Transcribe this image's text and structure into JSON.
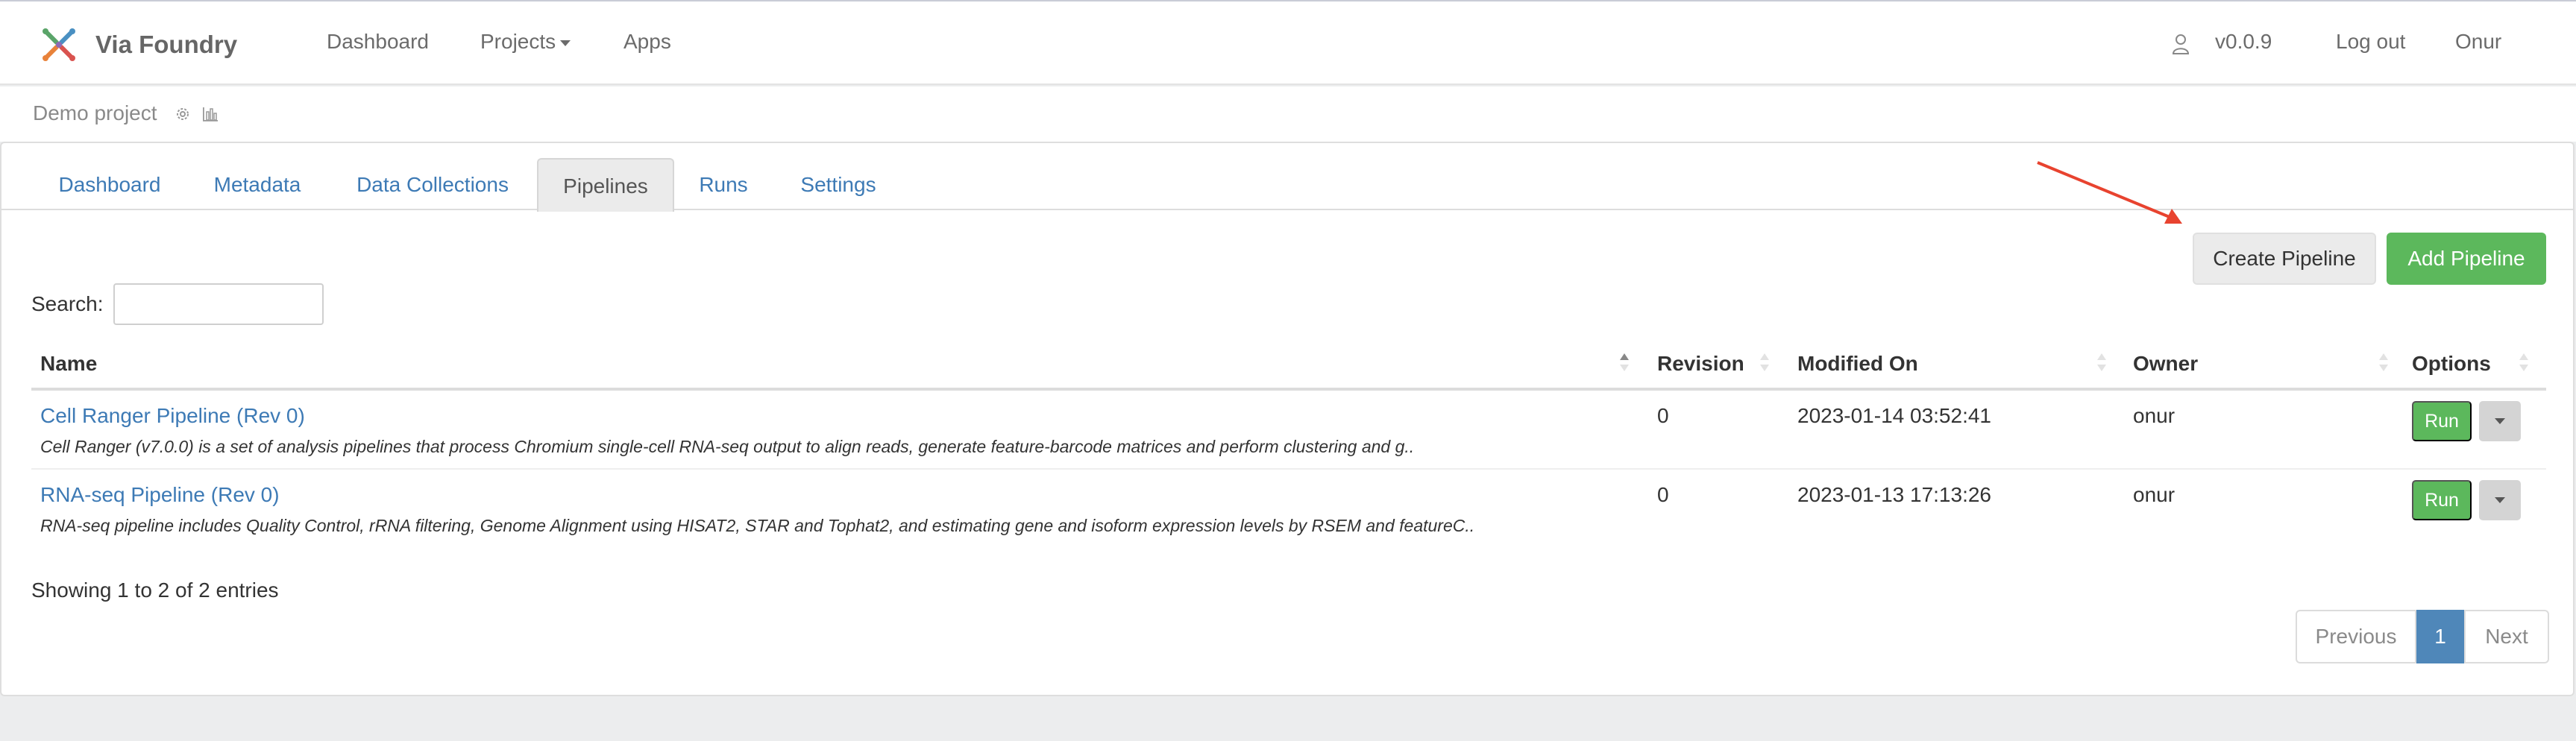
{
  "navbar": {
    "brand": "Via Foundry",
    "links": {
      "dashboard": "Dashboard",
      "projects": "Projects",
      "apps": "Apps"
    },
    "version": "v0.0.9",
    "logout": "Log out",
    "user": "Onur"
  },
  "project": {
    "name": "Demo project"
  },
  "tabs": [
    "Dashboard",
    "Metadata",
    "Data Collections",
    "Pipelines",
    "Runs",
    "Settings"
  ],
  "active_tab": "Pipelines",
  "actions": {
    "create": "Create Pipeline",
    "add": "Add Pipeline"
  },
  "search": {
    "label": "Search:",
    "value": ""
  },
  "table": {
    "headers": {
      "name": "Name",
      "revision": "Revision",
      "modified": "Modified On",
      "owner": "Owner",
      "options": "Options"
    },
    "rows": [
      {
        "name": "Cell Ranger Pipeline (Rev 0)",
        "description": "Cell Ranger (v7.0.0) is a set of analysis pipelines that process Chromium single-cell RNA-seq output to align reads, generate feature-barcode matrices and perform clustering and g..",
        "revision": "0",
        "modified": "2023-01-14 03:52:41",
        "owner": "onur",
        "run": "Run"
      },
      {
        "name": "RNA-seq Pipeline (Rev 0)",
        "description": "RNA-seq pipeline includes Quality Control, rRNA filtering, Genome Alignment using HISAT2, STAR and Tophat2, and estimating gene and isoform expression levels by RSEM and featureC..",
        "revision": "0",
        "modified": "2023-01-13 17:13:26",
        "owner": "onur",
        "run": "Run"
      }
    ]
  },
  "info": "Showing 1 to 2 of 2 entries",
  "pagination": {
    "previous": "Previous",
    "current": "1",
    "next": "Next"
  },
  "colors": {
    "accent": "#3d7ab5",
    "success": "#5cb85c",
    "page_active": "#4f87b9",
    "annotation_arrow": "#e8432f"
  },
  "icons": {
    "brand": "via-foundry-logo",
    "user": "user-icon",
    "project_settings": "gear-icon",
    "project_stats": "bar-chart-icon"
  }
}
